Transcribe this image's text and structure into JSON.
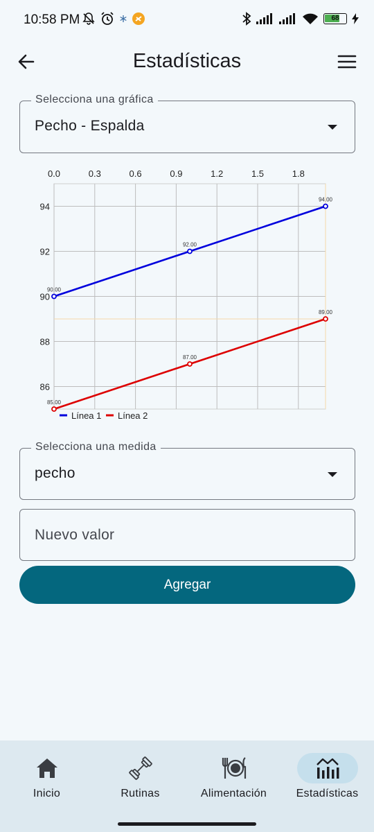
{
  "status": {
    "time": "10:58 PM",
    "battery": "68"
  },
  "header": {
    "title": "Estadísticas"
  },
  "chart_select": {
    "label": "Selecciona una gráfica",
    "value": "Pecho - Espalda"
  },
  "measure_select": {
    "label": "Selecciona una medida",
    "value": "pecho"
  },
  "new_value": {
    "placeholder": "Nuevo valor"
  },
  "add_button": {
    "label": "Agregar"
  },
  "nav": {
    "items": [
      {
        "label": "Inicio",
        "icon": "home-icon"
      },
      {
        "label": "Rutinas",
        "icon": "dumbbell-icon"
      },
      {
        "label": "Alimentación",
        "icon": "plate-icon"
      },
      {
        "label": "Estadísticas",
        "icon": "stats-icon",
        "active": true
      }
    ]
  },
  "colors": {
    "accent": "#04677e",
    "line1": "#0000dd",
    "line2": "#dd0000",
    "nav_bg": "#dde9f0",
    "nav_active": "#c5dfec"
  },
  "chart_data": {
    "type": "line",
    "xlim": [
      0,
      2
    ],
    "ylim": [
      85,
      95
    ],
    "x_ticks": [
      "0.0",
      "0.3",
      "0.6",
      "0.9",
      "1.2",
      "1.5",
      "1.8"
    ],
    "x_tick_values": [
      0,
      0.3,
      0.6,
      0.9,
      1.2,
      1.5,
      1.8
    ],
    "y_ticks": [
      "86",
      "88",
      "90",
      "92",
      "94"
    ],
    "y_tick_values": [
      86,
      88,
      90,
      92,
      94
    ],
    "x_axis_position": "top",
    "grid": true,
    "legend_position": "bottom-left",
    "series": [
      {
        "name": "Línea 1",
        "color": "#0000dd",
        "x": [
          0,
          1,
          2
        ],
        "y": [
          90,
          92,
          94
        ],
        "labels": [
          "90.00",
          "92.00",
          "94.00"
        ]
      },
      {
        "name": "Línea 2",
        "color": "#dd0000",
        "x": [
          0,
          1,
          2
        ],
        "y": [
          85,
          87,
          89
        ],
        "labels": [
          "85.00",
          "87.00",
          "89.00"
        ]
      }
    ],
    "highlight_y": 89
  }
}
